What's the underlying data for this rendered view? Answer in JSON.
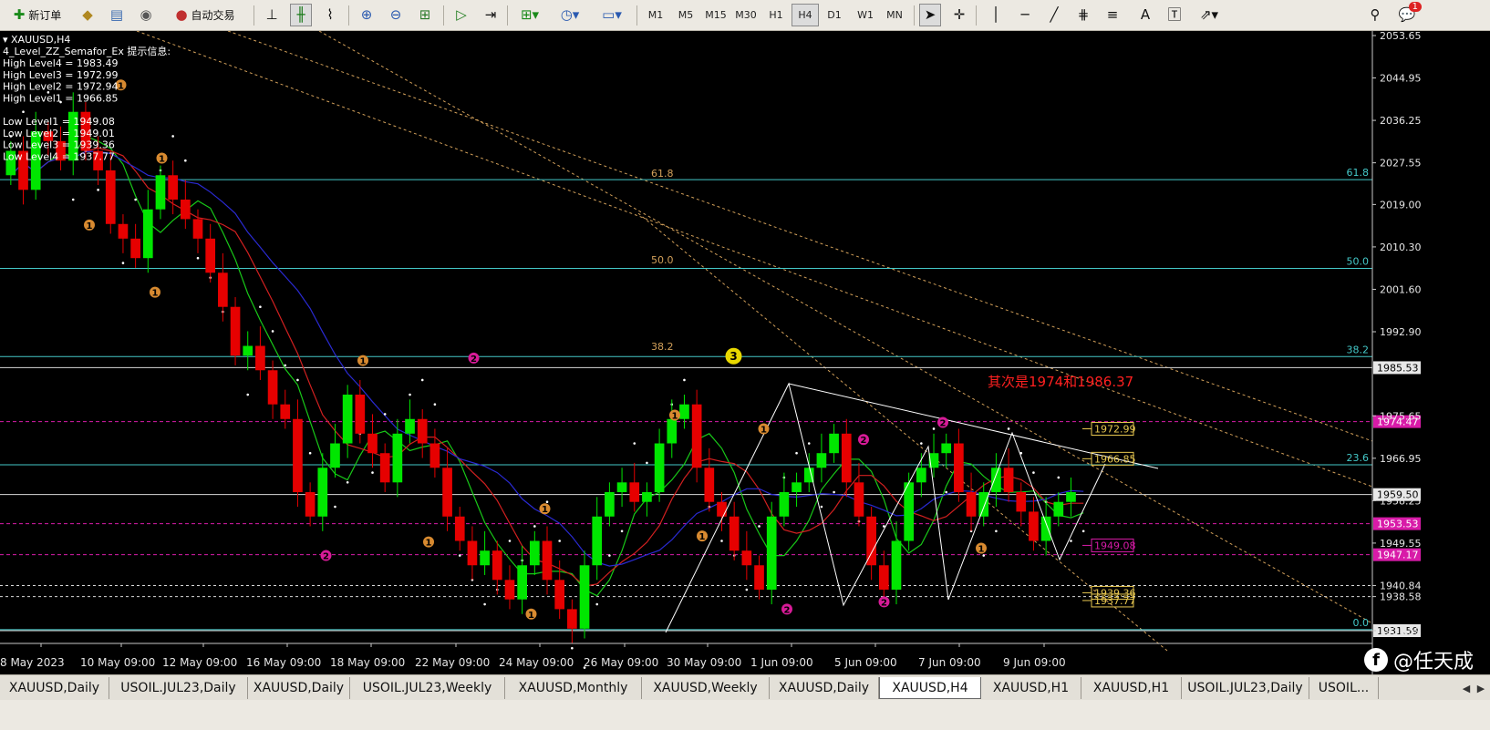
{
  "toolbar": {
    "new_order": "新订单",
    "auto_trading": "自动交易",
    "timeframes": [
      "M1",
      "M5",
      "M15",
      "M30",
      "H1",
      "H4",
      "D1",
      "W1",
      "MN"
    ],
    "active_timeframe": "H4",
    "notification_count": "1",
    "icons": [
      "new-order-icon",
      "strategy-tester-icon",
      "market-watch-icon",
      "signals-icon",
      "auto-trading-icon",
      "bar-chart-icon",
      "candlestick-icon",
      "line-chart-icon",
      "zoom-in-icon",
      "zoom-out-icon",
      "tile-windows-icon",
      "autoscroll-icon",
      "chart-shift-icon",
      "indicators-icon",
      "periods-icon",
      "templates-icon",
      "cursor-icon",
      "crosshair-icon",
      "vertical-line-icon",
      "horizontal-line-icon",
      "trendline-icon",
      "fibonacci-icon",
      "text-icon",
      "text-label-icon",
      "arrows-icon",
      "search-icon",
      "chat-icon"
    ]
  },
  "chart": {
    "symbol_header": "XAUUSD,H4",
    "indicator_name": "4_Level_ZZ_Semafor_Ex 提示信息:",
    "info_lines": [
      "High Level4 = 1983.49",
      "High Level3 = 1972.99",
      "High Level2 = 1972.94",
      "High Level1 = 1966.85",
      "",
      "Low Level1 = 1949.08",
      "Low Level2 = 1949.01",
      "Low Level3 = 1939.36",
      "Low Level4 = 1937.77"
    ],
    "price_axis": [
      "2053.65",
      "2044.95",
      "2036.25",
      "2027.55",
      "2019.00",
      "2010.30",
      "2001.60",
      "1992.90",
      "1975.65",
      "1966.95",
      "1958.25",
      "1949.55",
      "1940.84",
      "1938.58",
      "1931.59"
    ],
    "price_axis_values": [
      2053.65,
      2044.95,
      2036.25,
      2027.55,
      2019.0,
      2010.3,
      2001.6,
      1992.9,
      1975.65,
      1966.95,
      1958.25,
      1949.55,
      1940.84,
      1938.58,
      1931.59
    ],
    "time_axis": [
      "8 May 2023",
      "10 May 09:00",
      "12 May 09:00",
      "16 May 09:00",
      "18 May 09:00",
      "22 May 09:00",
      "24 May 09:00",
      "26 May 09:00",
      "30 May 09:00",
      "1 Jun 09:00",
      "5 Jun 09:00",
      "7 Jun 09:00",
      "9 Jun 09:00"
    ],
    "price_tags": [
      {
        "label": "1985.53",
        "price": 1985.53,
        "style": "white"
      },
      {
        "label": "1974.47",
        "price": 1974.47,
        "style": "magenta"
      },
      {
        "label": "1959.50",
        "price": 1959.5,
        "style": "white"
      },
      {
        "label": "1953.53",
        "price": 1953.53,
        "style": "magenta"
      },
      {
        "label": "1947.17",
        "price": 1947.17,
        "style": "magenta"
      },
      {
        "label": "1931.59",
        "price": 1931.59,
        "style": "white"
      }
    ],
    "fib_levels": [
      {
        "label": "61.8",
        "price": 2024.1
      },
      {
        "label": "50.0",
        "price": 2005.9
      },
      {
        "label": "38.2",
        "price": 1987.8
      },
      {
        "label": "23.6",
        "price": 1965.6
      },
      {
        "label": "0.0",
        "price": 1931.8
      }
    ],
    "fan_labels": [
      "61.8",
      "50.0",
      "38.2"
    ],
    "level_boxes": [
      {
        "label": "1972.99",
        "price": 1972.99
      },
      {
        "label": "1966.85",
        "price": 1966.85
      },
      {
        "label": "1949.08",
        "price": 1949.08
      },
      {
        "label": "1939.36",
        "price": 1939.36
      },
      {
        "label": "1937.77",
        "price": 1937.77
      }
    ],
    "annotation": "其次是1974和1986.37",
    "semafor_marks": [
      {
        "text": "1",
        "price": 2043.5,
        "t": 0.085
      },
      {
        "text": "1",
        "price": 2028.5,
        "t": 0.115
      },
      {
        "text": "1",
        "price": 2014.8,
        "t": 0.062
      },
      {
        "text": "1",
        "price": 2001.0,
        "t": 0.11
      },
      {
        "text": "1",
        "price": 1987.0,
        "t": 0.262
      },
      {
        "text": "1",
        "price": 1949.8,
        "t": 0.31
      },
      {
        "text": "1",
        "price": 1956.6,
        "t": 0.395
      },
      {
        "text": "1",
        "price": 1935.0,
        "t": 0.385
      },
      {
        "text": "1",
        "price": 1975.8,
        "t": 0.49
      },
      {
        "text": "1",
        "price": 1951.0,
        "t": 0.51
      },
      {
        "text": "1",
        "price": 1948.5,
        "t": 0.714
      },
      {
        "text": "1",
        "price": 1973.0,
        "t": 0.555
      },
      {
        "text": "2",
        "price": 1987.5,
        "t": 0.343
      },
      {
        "text": "2",
        "price": 1947.0,
        "t": 0.235
      },
      {
        "text": "2",
        "price": 1970.8,
        "t": 0.628
      },
      {
        "text": "2",
        "price": 1936.0,
        "t": 0.572
      },
      {
        "text": "2",
        "price": 1974.3,
        "t": 0.686
      },
      {
        "text": "2",
        "price": 1937.5,
        "t": 0.643
      },
      {
        "text": "3",
        "price": 1987.9,
        "t": 0.533
      }
    ],
    "colors": {
      "bull": "#00e600",
      "bear": "#e60000",
      "grid": "#1e1e1e",
      "fib": "#44c8c8",
      "fan": "#d2a05a",
      "magenta": "#d81ba8",
      "ma_green": "#18c818",
      "ma_red": "#d22020",
      "ma_blue": "#2a2ad2",
      "semafor_orange": "#d88a30",
      "semafor_pink": "#d81b98",
      "semafor_yellow": "#e8d800"
    }
  },
  "tabs": [
    "XAUUSD,Daily",
    "USOIL.JUL23,Daily",
    "XAUUSD,Daily",
    "USOIL.JUL23,Weekly",
    "XAUUSD,Monthly",
    "XAUUSD,Weekly",
    "XAUUSD,Daily",
    "XAUUSD,H4",
    "XAUUSD,H1",
    "XAUUSD,H1",
    "USOIL.JUL23,Daily",
    "USOIL..."
  ],
  "active_tab": "XAUUSD,H4",
  "watermark": "@任天成"
}
